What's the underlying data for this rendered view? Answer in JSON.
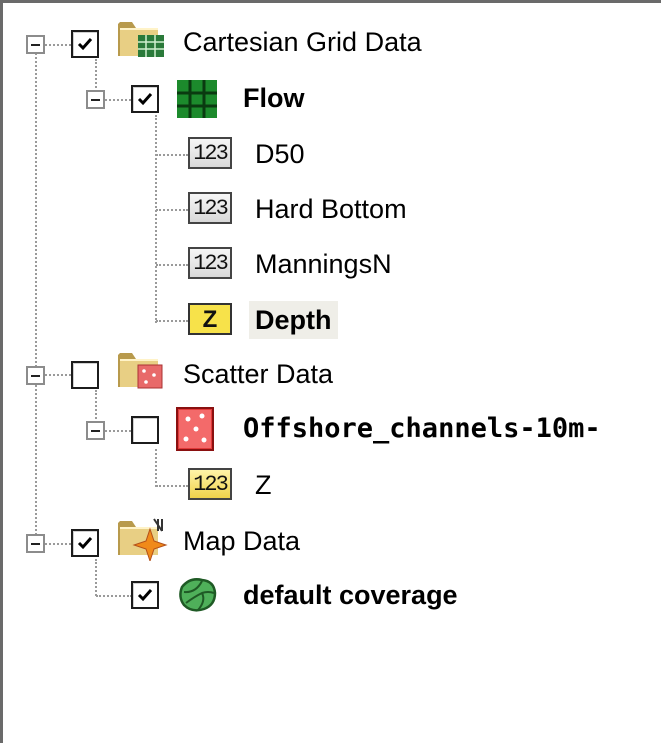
{
  "tree": {
    "cartesian_grid": {
      "label": "Cartesian Grid Data",
      "checked": true
    },
    "flow": {
      "label": "Flow",
      "checked": true
    },
    "d50": {
      "label": "D50",
      "icon_text": "123"
    },
    "hard_bottom": {
      "label": "Hard Bottom",
      "icon_text": "123"
    },
    "manningsn": {
      "label": "ManningsN",
      "icon_text": "123"
    },
    "depth": {
      "label": "Depth",
      "icon_text": "Z"
    },
    "scatter": {
      "label": "Scatter Data",
      "checked": false
    },
    "offshore": {
      "label": "Offshore_channels-10m-",
      "checked": false
    },
    "z": {
      "label": "Z",
      "icon_text": "123"
    },
    "map": {
      "label": "Map Data",
      "checked": true
    },
    "coverage": {
      "label": "default coverage",
      "checked": true
    }
  },
  "colors": {
    "folder": "#d8c070",
    "grid_green": "#1c8a2c",
    "selected_bg": "#efeee8",
    "z_icon_yellow": "#f7e24a"
  }
}
